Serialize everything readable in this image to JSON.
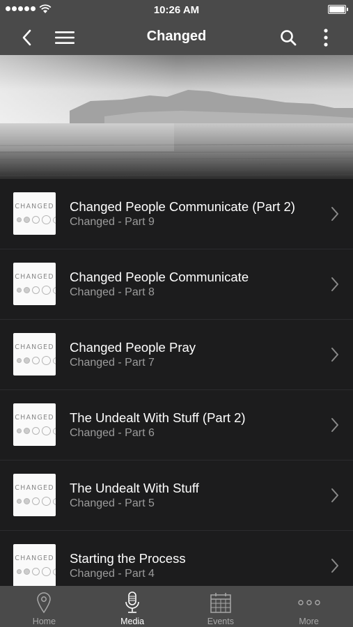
{
  "status": {
    "time": "10:26 AM"
  },
  "nav": {
    "title": "Changed",
    "back_icon": "chevron-left-icon",
    "menu_icon": "hamburger-icon",
    "search_icon": "search-icon",
    "more_icon": "vertical-ellipsis-icon"
  },
  "hero": {
    "image": "ocean-mountains-grayscale"
  },
  "items": [
    {
      "title": "Changed People Communicate (Part 2)",
      "subtitle": "Changed - Part 9",
      "thumb_text": "CHANGED"
    },
    {
      "title": "Changed People Communicate",
      "subtitle": "Changed - Part 8",
      "thumb_text": "CHANGED"
    },
    {
      "title": "Changed People Pray",
      "subtitle": "Changed - Part 7",
      "thumb_text": "CHANGED"
    },
    {
      "title": "The Undealt With Stuff (Part 2)",
      "subtitle": "Changed - Part 6",
      "thumb_text": "CHANGED"
    },
    {
      "title": "The Undealt With Stuff",
      "subtitle": "Changed - Part 5",
      "thumb_text": "CHANGED"
    },
    {
      "title": "Starting the Process",
      "subtitle": "Changed - Part 4",
      "thumb_text": "CHANGED"
    }
  ],
  "tabs": [
    {
      "label": "Home",
      "icon": "map-pin-icon",
      "active": false
    },
    {
      "label": "Media",
      "icon": "microphone-icon",
      "active": true
    },
    {
      "label": "Events",
      "icon": "calendar-icon",
      "active": false
    },
    {
      "label": "More",
      "icon": "more-dots-icon",
      "active": false
    }
  ]
}
